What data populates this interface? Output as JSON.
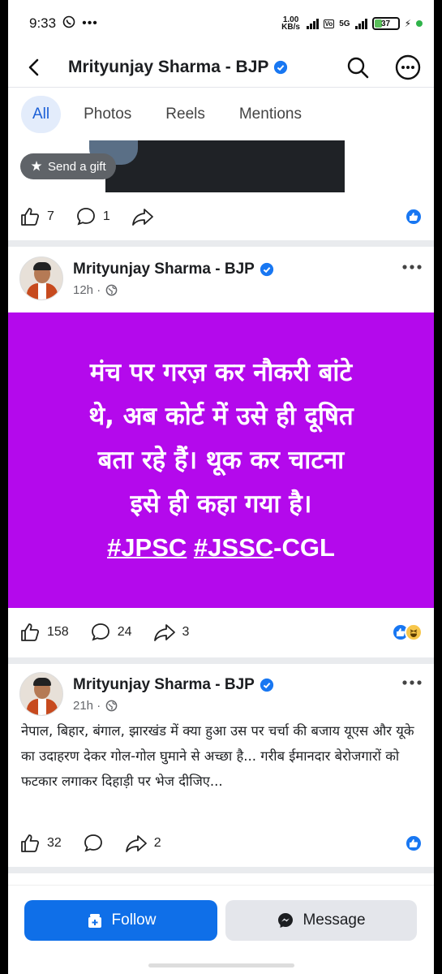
{
  "status_bar": {
    "time": "9:33",
    "speed": "1.00 KB/s",
    "network": "5G",
    "battery": "37"
  },
  "header": {
    "title": "Mrityunjay Sharma - BJP"
  },
  "tabs": [
    {
      "label": "All",
      "active": true
    },
    {
      "label": "Photos",
      "active": false
    },
    {
      "label": "Reels",
      "active": false
    },
    {
      "label": "Mentions",
      "active": false
    }
  ],
  "photo_post": {
    "gift_label": "Send a gift",
    "likes": "7",
    "comments": "1"
  },
  "post1": {
    "author": "Mrityunjay Sharma - BJP",
    "time": "12h ·",
    "text_line1": "मंच पर गरज़ कर नौकरी बांटे",
    "text_line2": "थे, अब कोर्ट में उसे ही दूषित",
    "text_line3": "बता रहे हैं। थूक कर चाटना",
    "text_line4": "इसे ही कहा गया है।",
    "hashtag1": "#JPSC",
    "hashtag2": "#JSSC",
    "hashtag2_suffix": "-CGL",
    "likes": "158",
    "comments": "24",
    "shares": "3"
  },
  "post2": {
    "author": "Mrityunjay Sharma - BJP",
    "time": "21h ·",
    "text": "नेपाल, बिहार, बंगाल, झारखंड में क्या हुआ उस पर चर्चा की बजाय यूएस और यूके का उदाहरण देकर गोल-गोल घुमाने से अच्छा है... गरीब ईमानदार बेरोजगारों को फटकार लगाकर दिहाड़ी पर भेज दीजिए...",
    "likes": "32",
    "shares": "2"
  },
  "bottom": {
    "follow_label": "Follow",
    "message_label": "Message"
  },
  "colors": {
    "accent": "#0f6fe8",
    "post_bg": "#b409ec"
  }
}
